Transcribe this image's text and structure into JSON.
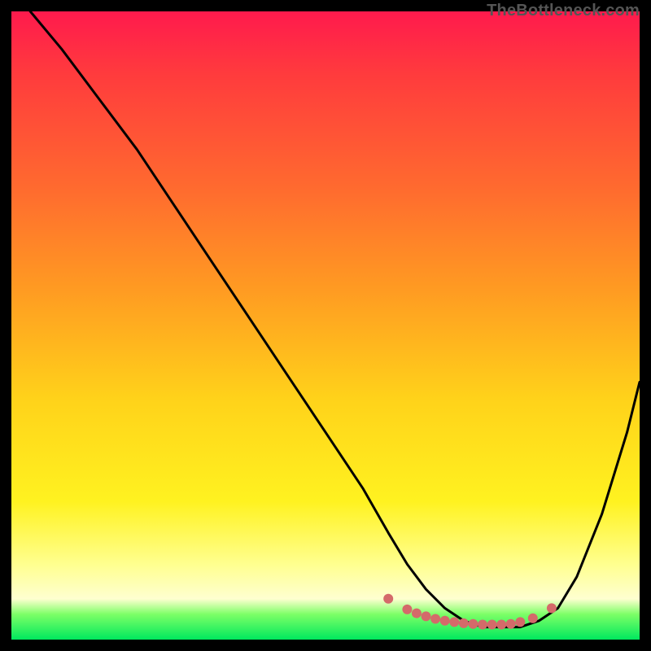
{
  "watermark": "TheBottleneck.com",
  "colors": {
    "background": "#000000",
    "curve_stroke": "#000000",
    "dot_fill": "#d46a6a",
    "gradient": [
      "#ff1a4d",
      "#ff3b3d",
      "#ff6a2f",
      "#ff9a22",
      "#ffd31a",
      "#fff220",
      "#ffff8f",
      "#feffd0",
      "#7bff66",
      "#00e85e"
    ]
  },
  "chart_data": {
    "type": "line",
    "title": "",
    "xlabel": "",
    "ylabel": "",
    "xlim": [
      0,
      100
    ],
    "ylim": [
      0,
      100
    ],
    "grid": false,
    "series": [
      {
        "name": "bottleneck-curve",
        "x": [
          3,
          8,
          14,
          20,
          26,
          32,
          38,
          44,
          50,
          56,
          60,
          63,
          66,
          69,
          72,
          75,
          78,
          81,
          84,
          87,
          90,
          94,
          98,
          100
        ],
        "values": [
          100,
          94,
          86,
          78,
          69,
          60,
          51,
          42,
          33,
          24,
          17,
          12,
          8,
          5,
          3,
          2,
          2,
          2,
          3,
          5,
          10,
          20,
          33,
          41
        ]
      }
    ],
    "dots": {
      "name": "optimal-range-markers",
      "x": [
        60.0,
        63.0,
        64.5,
        66.0,
        67.5,
        69.0,
        70.5,
        72.0,
        73.5,
        75.0,
        76.5,
        78.0,
        79.5,
        81.0,
        83.0,
        86.0
      ],
      "values": [
        6.5,
        4.8,
        4.2,
        3.7,
        3.3,
        3.0,
        2.8,
        2.6,
        2.5,
        2.4,
        2.4,
        2.4,
        2.5,
        2.8,
        3.4,
        5.0
      ]
    }
  }
}
